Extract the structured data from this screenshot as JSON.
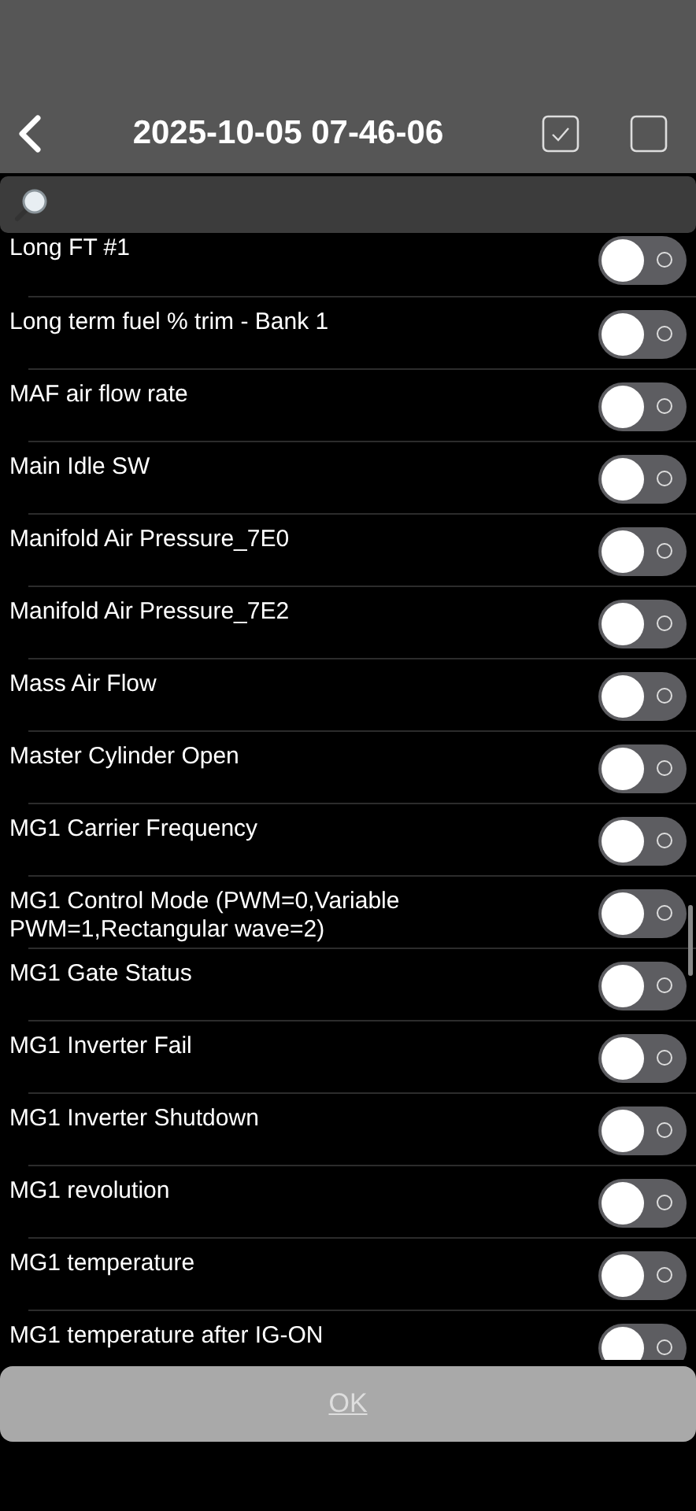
{
  "header": {
    "title": "2025-10-05 07-46-06"
  },
  "rows": [
    {
      "label": "Long FT #1",
      "on": false
    },
    {
      "label": "Long term fuel % trim - Bank 1",
      "on": false
    },
    {
      "label": "MAF air flow rate",
      "on": false
    },
    {
      "label": "Main Idle SW",
      "on": false
    },
    {
      "label": "Manifold Air Pressure_7E0",
      "on": false
    },
    {
      "label": "Manifold Air Pressure_7E2",
      "on": false
    },
    {
      "label": "Mass Air Flow",
      "on": false
    },
    {
      "label": "Master Cylinder Open",
      "on": false
    },
    {
      "label": "MG1 Carrier Frequency",
      "on": false
    },
    {
      "label": "MG1 Control Mode (PWM=0,Variable PWM=1,Rectangular wave=2)",
      "on": false
    },
    {
      "label": "MG1 Gate Status",
      "on": false
    },
    {
      "label": "MG1 Inverter Fail",
      "on": false
    },
    {
      "label": "MG1 Inverter Shutdown",
      "on": false
    },
    {
      "label": "MG1 revolution",
      "on": false
    },
    {
      "label": "MG1 temperature",
      "on": false
    },
    {
      "label": "MG1 temperature after IG-ON",
      "on": false
    }
  ],
  "ok_button": {
    "label": "OK",
    "disabled": true
  }
}
